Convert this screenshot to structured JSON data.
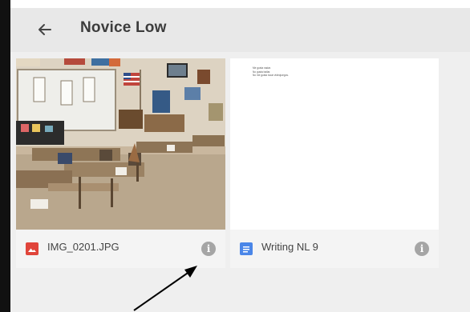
{
  "header": {
    "title": "Novice Low",
    "back_icon": "arrow-left-icon"
  },
  "files": [
    {
      "name": "IMG_0201.JPG",
      "type": "image",
      "icon": "image-file-icon",
      "icon_color": "#e0453b"
    },
    {
      "name": "Writing NL 9",
      "type": "document",
      "icon": "docs-file-icon",
      "icon_color": "#4a86e8",
      "preview_lines": [
        "Me gusta nadar.",
        "No gusta bailar.",
        "No me gusta tocar videojuegos."
      ]
    }
  ],
  "colors": {
    "header_bg": "#e8e8e8",
    "content_bg": "#efefef",
    "title": "#3c3c3c",
    "info": "#a5a5a5"
  }
}
